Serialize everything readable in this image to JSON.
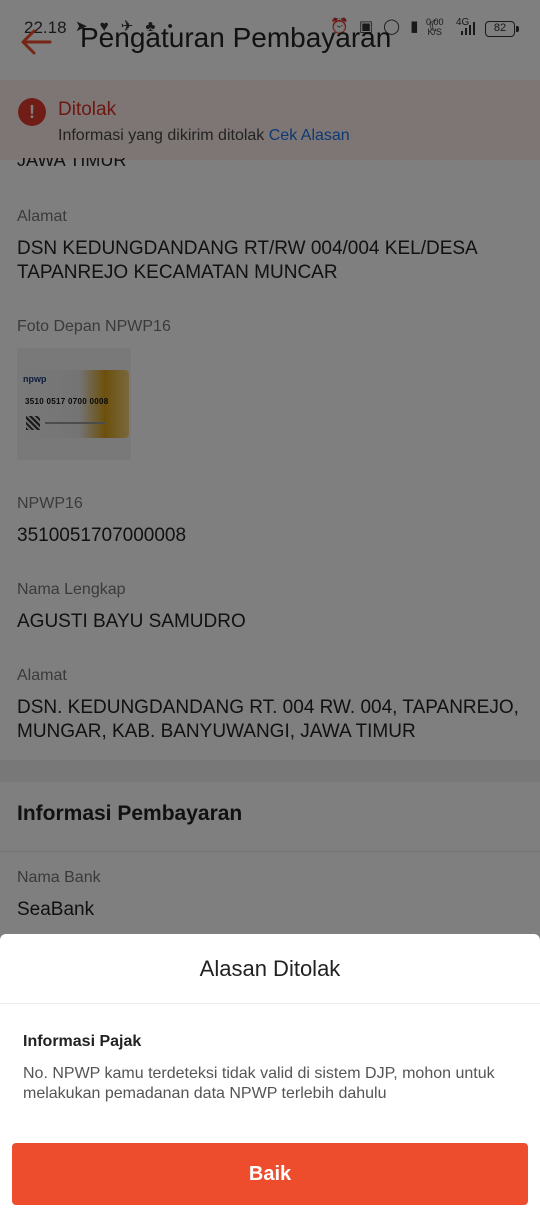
{
  "status_bar": {
    "time": "22.18",
    "net_speed_value": "0,00",
    "net_speed_unit": "K/S",
    "network": "4G",
    "battery": "82"
  },
  "header": {
    "title": "Pengaturan Pembayaran"
  },
  "alert": {
    "title": "Ditolak",
    "message": "Informasi yang dikirim ditolak",
    "link": "Cek Alasan"
  },
  "ktp": {
    "cutoff_value": "JAWA TIMUR",
    "address_label": "Alamat",
    "address_value": "DSN KEDUNGDANDANG RT/RW 004/004 KEL/DESA TAPANREJO KECAMATAN MUNCAR"
  },
  "npwp": {
    "photo_label": "Foto Depan NPWP16",
    "card_logo": "npwp",
    "card_number": "3510 0517 0700 0008",
    "number_label": "NPWP16",
    "number_value": "3510051707000008",
    "name_label": "Nama Lengkap",
    "name_value": "AGUSTI BAYU SAMUDRO",
    "address_label": "Alamat",
    "address_value": "DSN. KEDUNGDANDANG RT. 004 RW. 004, TAPANREJO, MUNGAR, KAB. BANYUWANGI, JAWA TIMUR"
  },
  "payment": {
    "section_title": "Informasi Pembayaran",
    "bank_label": "Nama Bank",
    "bank_value": "SeaBank"
  },
  "sheet": {
    "title": "Alasan Ditolak",
    "subtitle": "Informasi Pajak",
    "description": "No. NPWP kamu terdeteksi tidak valid di sistem DJP, mohon untuk melakukan pemadanan data NPWP terlebih dahulu",
    "button_label": "Baik"
  },
  "colors": {
    "accent": "#ee4d2d",
    "error": "#d93025",
    "link": "#1a73e8"
  }
}
